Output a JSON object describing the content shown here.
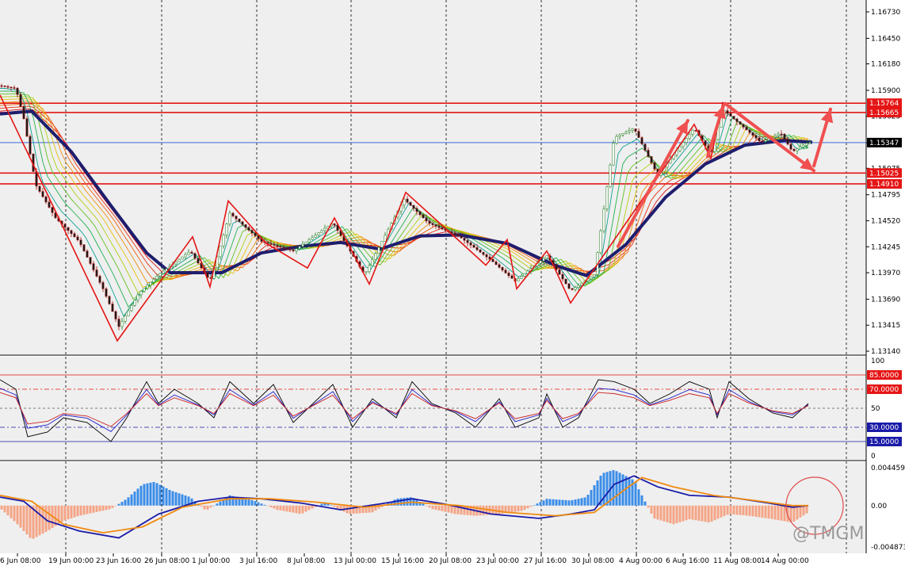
{
  "colors": {
    "background": "#efefef",
    "grid": "#000000",
    "level_red": "#e51515",
    "current_blue": "#3b6cd8",
    "ma_slow": "#1e1e6e",
    "zigzag": "#e51515",
    "arrow": "#f05050",
    "stoch_black": "#000000",
    "stoch_blue": "#2020cc",
    "stoch_red": "#cc2020",
    "macd_pos": "#3b8de8",
    "macd_neg": "#f4a486",
    "macd_line": "#1a1aa8",
    "signal_line": "#f08a10",
    "circle": "#e04a4a"
  },
  "price_axis": {
    "ticks": [
      "1.16730",
      "1.16450",
      "1.16180",
      "1.15900",
      "1.15625",
      "1.15345",
      "1.15075",
      "1.14795",
      "1.14520",
      "1.14245",
      "1.13970",
      "1.13690",
      "1.13415",
      "1.13140"
    ]
  },
  "levels": [
    {
      "label": "1.15764",
      "value": 1.15764
    },
    {
      "label": "1.15665",
      "value": 1.15665
    },
    {
      "label": "1.15025",
      "value": 1.15025
    },
    {
      "label": "1.14910",
      "value": 1.1491
    }
  ],
  "current_price": {
    "label": "1.15347",
    "value": 1.15347
  },
  "stoch_axis": {
    "ticks": [
      "100",
      "50",
      "0"
    ],
    "levels": [
      "85.0000",
      "70.0000",
      "30.0000",
      "15.0000"
    ]
  },
  "macd_axis": {
    "ticks": [
      "0.0044593",
      "0.00",
      "-0.0048737"
    ]
  },
  "time_axis": {
    "labels": [
      "6 Jun 08:00",
      "19 Jun 00:00",
      "23 Jun 16:00",
      "26 Jun 08:00",
      "1 Jul 00:00",
      "3 Jul 16:00",
      "8 Jul 08:00",
      "13 Jul 00:00",
      "15 Jul 16:00",
      "20 Jul 08:00",
      "23 Jul 00:00",
      "27 Jul 16:00",
      "30 Jul 08:00",
      "4 Aug 00:00",
      "6 Aug 16:00",
      "11 Aug 08:00",
      "14 Aug 00:00"
    ]
  },
  "watermark": "@TMGM",
  "chart_data": [
    {
      "type": "line",
      "name": "price",
      "zigzag_points": [
        {
          "x": 0,
          "y": 1.1585
        },
        {
          "x": 148,
          "y": 1.1325
        },
        {
          "x": 243,
          "y": 1.1435
        },
        {
          "x": 265,
          "y": 1.1382
        },
        {
          "x": 288,
          "y": 1.1473
        },
        {
          "x": 336,
          "y": 1.1428
        },
        {
          "x": 388,
          "y": 1.1402
        },
        {
          "x": 422,
          "y": 1.1455
        },
        {
          "x": 466,
          "y": 1.1385
        },
        {
          "x": 512,
          "y": 1.1482
        },
        {
          "x": 566,
          "y": 1.1441
        },
        {
          "x": 613,
          "y": 1.1405
        },
        {
          "x": 640,
          "y": 1.1432
        },
        {
          "x": 652,
          "y": 1.138
        },
        {
          "x": 690,
          "y": 1.142
        },
        {
          "x": 720,
          "y": 1.1365
        },
        {
          "x": 876,
          "y": 1.1554
        },
        {
          "x": 897,
          "y": 1.1518
        },
        {
          "x": 912,
          "y": 1.1577
        },
        {
          "x": 1002,
          "y": 1.1521
        }
      ],
      "ma_slow_points": [
        {
          "x": 0,
          "y": 1.1565
        },
        {
          "x": 40,
          "y": 1.1568
        },
        {
          "x": 90,
          "y": 1.1525
        },
        {
          "x": 140,
          "y": 1.1468
        },
        {
          "x": 185,
          "y": 1.1418
        },
        {
          "x": 215,
          "y": 1.1397
        },
        {
          "x": 280,
          "y": 1.1397
        },
        {
          "x": 330,
          "y": 1.1418
        },
        {
          "x": 380,
          "y": 1.1425
        },
        {
          "x": 430,
          "y": 1.1429
        },
        {
          "x": 480,
          "y": 1.1422
        },
        {
          "x": 530,
          "y": 1.1436
        },
        {
          "x": 580,
          "y": 1.1437
        },
        {
          "x": 640,
          "y": 1.1428
        },
        {
          "x": 700,
          "y": 1.1405
        },
        {
          "x": 740,
          "y": 1.1394
        },
        {
          "x": 790,
          "y": 1.1427
        },
        {
          "x": 840,
          "y": 1.1477
        },
        {
          "x": 890,
          "y": 1.1512
        },
        {
          "x": 940,
          "y": 1.1532
        },
        {
          "x": 990,
          "y": 1.1537
        },
        {
          "x": 1025,
          "y": 1.1535
        }
      ],
      "price_path": [
        {
          "x": 0,
          "y": 1.1595
        },
        {
          "x": 20,
          "y": 1.1592
        },
        {
          "x": 30,
          "y": 1.156
        },
        {
          "x": 45,
          "y": 1.149
        },
        {
          "x": 70,
          "y": 1.1455
        },
        {
          "x": 100,
          "y": 1.143
        },
        {
          "x": 130,
          "y": 1.138
        },
        {
          "x": 150,
          "y": 1.134
        },
        {
          "x": 175,
          "y": 1.1375
        },
        {
          "x": 200,
          "y": 1.1395
        },
        {
          "x": 240,
          "y": 1.142
        },
        {
          "x": 265,
          "y": 1.1388
        },
        {
          "x": 290,
          "y": 1.146
        },
        {
          "x": 330,
          "y": 1.143
        },
        {
          "x": 370,
          "y": 1.142
        },
        {
          "x": 420,
          "y": 1.145
        },
        {
          "x": 460,
          "y": 1.1395
        },
        {
          "x": 510,
          "y": 1.1475
        },
        {
          "x": 540,
          "y": 1.145
        },
        {
          "x": 580,
          "y": 1.1435
        },
        {
          "x": 620,
          "y": 1.141
        },
        {
          "x": 650,
          "y": 1.1388
        },
        {
          "x": 690,
          "y": 1.1415
        },
        {
          "x": 720,
          "y": 1.1378
        },
        {
          "x": 750,
          "y": 1.1395
        },
        {
          "x": 775,
          "y": 1.154
        },
        {
          "x": 800,
          "y": 1.155
        },
        {
          "x": 830,
          "y": 1.15
        },
        {
          "x": 876,
          "y": 1.155
        },
        {
          "x": 897,
          "y": 1.1522
        },
        {
          "x": 912,
          "y": 1.157
        },
        {
          "x": 960,
          "y": 1.1535
        },
        {
          "x": 985,
          "y": 1.1545
        },
        {
          "x": 1000,
          "y": 1.1525
        },
        {
          "x": 1020,
          "y": 1.1535
        }
      ],
      "arrows": [
        {
          "from": {
            "x": 780,
            "y": 1.1425
          },
          "to": {
            "x": 868,
            "y": 1.1558
          }
        },
        {
          "from": {
            "x": 893,
            "y": 1.152
          },
          "to": {
            "x": 913,
            "y": 1.1574
          }
        },
        {
          "from": {
            "x": 915,
            "y": 1.1576
          },
          "to": {
            "x": 1027,
            "y": 1.1505
          }
        },
        {
          "from": {
            "x": 1027,
            "y": 1.151
          },
          "to": {
            "x": 1048,
            "y": 1.157
          }
        }
      ]
    },
    {
      "type": "line",
      "name": "stochastic",
      "ylim": [
        0,
        100
      ],
      "series": [
        {
          "values": [
            [
              0,
              80
            ],
            [
              20,
              70
            ],
            [
              35,
              20
            ],
            [
              60,
              25
            ],
            [
              80,
              40
            ],
            [
              110,
              35
            ],
            [
              140,
              15
            ],
            [
              160,
              40
            ],
            [
              185,
              78
            ],
            [
              200,
              55
            ],
            [
              220,
              70
            ],
            [
              250,
              55
            ],
            [
              270,
              40
            ],
            [
              290,
              78
            ],
            [
              320,
              55
            ],
            [
              345,
              75
            ],
            [
              370,
              35
            ],
            [
              395,
              55
            ],
            [
              420,
              75
            ],
            [
              445,
              30
            ],
            [
              470,
              60
            ],
            [
              500,
              40
            ],
            [
              520,
              78
            ],
            [
              545,
              55
            ],
            [
              575,
              45
            ],
            [
              600,
              30
            ],
            [
              630,
              60
            ],
            [
              650,
              30
            ],
            [
              680,
              40
            ],
            [
              690,
              65
            ],
            [
              710,
              30
            ],
            [
              730,
              40
            ],
            [
              755,
              80
            ],
            [
              775,
              78
            ],
            [
              800,
              70
            ],
            [
              820,
              55
            ],
            [
              845,
              65
            ],
            [
              870,
              78
            ],
            [
              895,
              70
            ],
            [
              905,
              40
            ],
            [
              920,
              78
            ],
            [
              945,
              60
            ],
            [
              975,
              45
            ],
            [
              1000,
              40
            ],
            [
              1020,
              55
            ]
          ]
        }
      ]
    },
    {
      "type": "bar",
      "name": "macd",
      "histogram_points": [
        [
          0,
          -0.0003
        ],
        [
          20,
          -0.002
        ],
        [
          40,
          -0.004
        ],
        [
          60,
          -0.003
        ],
        [
          80,
          -0.0018
        ],
        [
          100,
          -0.0012
        ],
        [
          120,
          -0.0008
        ],
        [
          140,
          -0.0004
        ],
        [
          160,
          0.0008
        ],
        [
          180,
          0.0025
        ],
        [
          195,
          0.0028
        ],
        [
          215,
          0.0018
        ],
        [
          240,
          0.001
        ],
        [
          260,
          -0.0006
        ],
        [
          290,
          0.0012
        ],
        [
          320,
          0.0006
        ],
        [
          350,
          -0.0005
        ],
        [
          380,
          -0.001
        ],
        [
          410,
          0.0004
        ],
        [
          440,
          -0.001
        ],
        [
          470,
          -0.0008
        ],
        [
          500,
          0.0008
        ],
        [
          520,
          0.001
        ],
        [
          545,
          -0.0004
        ],
        [
          575,
          -0.001
        ],
        [
          600,
          -0.0012
        ],
        [
          630,
          -0.001
        ],
        [
          660,
          -0.0006
        ],
        [
          690,
          0.0008
        ],
        [
          720,
          0.0006
        ],
        [
          740,
          0.001
        ],
        [
          760,
          0.0038
        ],
        [
          775,
          0.0042
        ],
        [
          800,
          0.003
        ],
        [
          825,
          -0.0015
        ],
        [
          850,
          -0.0022
        ],
        [
          870,
          -0.0016
        ],
        [
          895,
          -0.002
        ],
        [
          920,
          -0.001
        ],
        [
          945,
          -0.0012
        ],
        [
          975,
          -0.0016
        ],
        [
          1000,
          -0.002
        ],
        [
          1020,
          -0.0008
        ]
      ],
      "macd_line": [
        [
          0,
          0.001
        ],
        [
          30,
          0.0005
        ],
        [
          60,
          -0.0018
        ],
        [
          100,
          -0.003
        ],
        [
          150,
          -0.0038
        ],
        [
          200,
          -0.001
        ],
        [
          250,
          0.0005
        ],
        [
          290,
          0.001
        ],
        [
          330,
          0.0008
        ],
        [
          380,
          0.0003
        ],
        [
          430,
          -0.0005
        ],
        [
          480,
          0.0002
        ],
        [
          520,
          0.0008
        ],
        [
          560,
          0.0002
        ],
        [
          620,
          -0.001
        ],
        [
          680,
          -0.0015
        ],
        [
          720,
          -0.001
        ],
        [
          750,
          -0.0005
        ],
        [
          775,
          0.0025
        ],
        [
          800,
          0.0035
        ],
        [
          830,
          0.0022
        ],
        [
          870,
          0.0012
        ],
        [
          920,
          0.001
        ],
        [
          970,
          0.0003
        ],
        [
          1000,
          -0.0002
        ],
        [
          1020,
          0.0
        ]
      ],
      "signal_line": [
        [
          0,
          0.0012
        ],
        [
          40,
          0.0005
        ],
        [
          80,
          -0.0022
        ],
        [
          130,
          -0.0032
        ],
        [
          180,
          -0.0025
        ],
        [
          230,
          -0.0002
        ],
        [
          290,
          0.0008
        ],
        [
          340,
          0.0008
        ],
        [
          400,
          0.0004
        ],
        [
          460,
          -0.0002
        ],
        [
          520,
          0.0004
        ],
        [
          580,
          0.0
        ],
        [
          640,
          -0.0008
        ],
        [
          700,
          -0.0012
        ],
        [
          750,
          -0.0008
        ],
        [
          790,
          0.002
        ],
        [
          810,
          0.0033
        ],
        [
          850,
          0.0022
        ],
        [
          900,
          0.0012
        ],
        [
          960,
          0.0005
        ],
        [
          1000,
          0.0
        ],
        [
          1020,
          0.0
        ]
      ]
    }
  ]
}
